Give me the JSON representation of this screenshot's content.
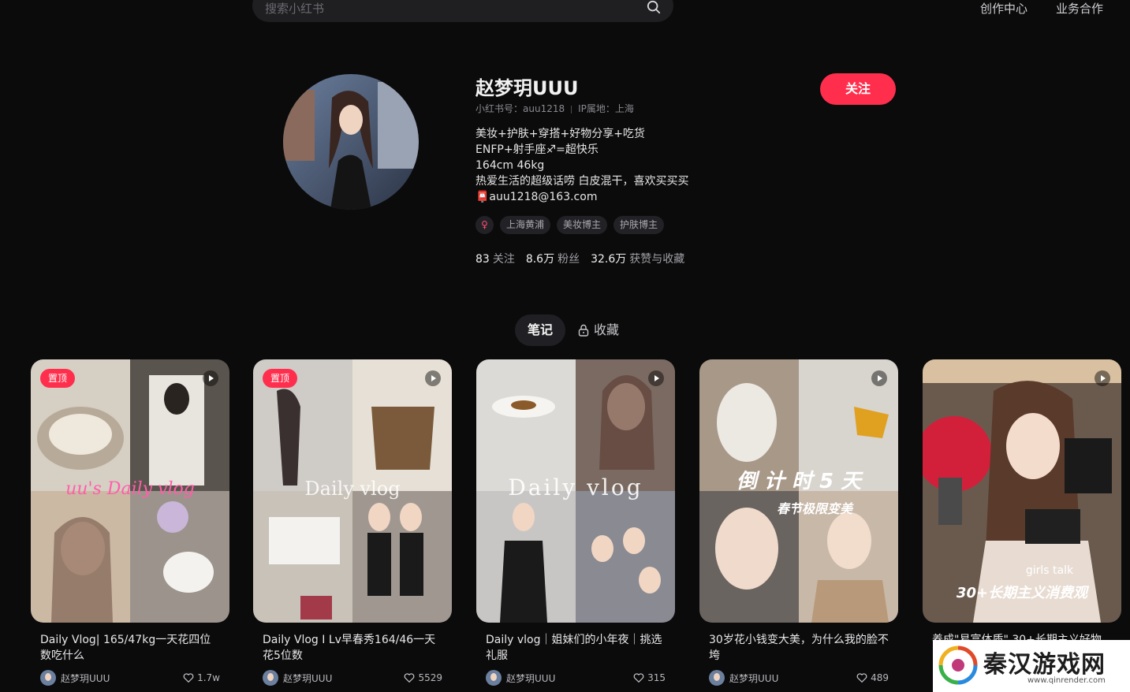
{
  "header": {
    "search_placeholder": "搜索小红书",
    "links": [
      "创作中心",
      "业务合作"
    ]
  },
  "profile": {
    "nickname": "赵梦玥UUU",
    "red_id": "小红书号：auu1218",
    "ip": "IP属地：上海",
    "bio": [
      "美妆+护肤+穿搭+好物分享+吃货",
      "ENFP+射手座♐=超快乐",
      "164cm 46kg",
      "热爱生活的超级话唠 白皮混干，喜欢买买买",
      "📮auu1218@163.com"
    ],
    "gender_icon": "♀",
    "tags": [
      "上海黄浦",
      "美妆博主",
      "护肤博主"
    ],
    "stats": [
      {
        "value": "83",
        "label": "关注"
      },
      {
        "value": "8.6万",
        "label": "粉丝"
      },
      {
        "value": "32.6万",
        "label": "获赞与收藏"
      }
    ],
    "follow_label": "关注"
  },
  "tabs": {
    "notes": "笔记",
    "collect": "收藏"
  },
  "cards": [
    {
      "pinned": "置顶",
      "overlay": "uu's Daily vlog",
      "title": "Daily Vlog| 165/47kg一天花四位数吃什么",
      "author": "赵梦玥UUU",
      "likes": "1.7w"
    },
    {
      "pinned": "置顶",
      "overlay": "Daily vlog",
      "title": "Daily Vlog I Lv早春秀164/46一天花5位数",
      "author": "赵梦玥UUU",
      "likes": "5529"
    },
    {
      "pinned": "",
      "overlay": "Daily vlog",
      "title": "Daily vlog｜姐妹们的小年夜｜挑选礼服",
      "author": "赵梦玥UUU",
      "likes": "315"
    },
    {
      "pinned": "",
      "overlay": "倒 计 时 5 天",
      "overlay2": "春节极限变美",
      "title": "30岁花小钱变大美，为什么我的脸不垮",
      "author": "赵梦玥UUU",
      "likes": "489"
    },
    {
      "pinned": "",
      "overlay": "girls talk",
      "overlay2": "30+长期主义消费观",
      "title": "养成\"易富体质\" 30+长期主义好物",
      "author": "",
      "likes": ""
    }
  ],
  "watermark": {
    "text": "秦汉游戏网",
    "url": "www.qinrender.com"
  },
  "colors": {
    "accent": "#ff2e4d",
    "background": "#0b0b0c"
  }
}
